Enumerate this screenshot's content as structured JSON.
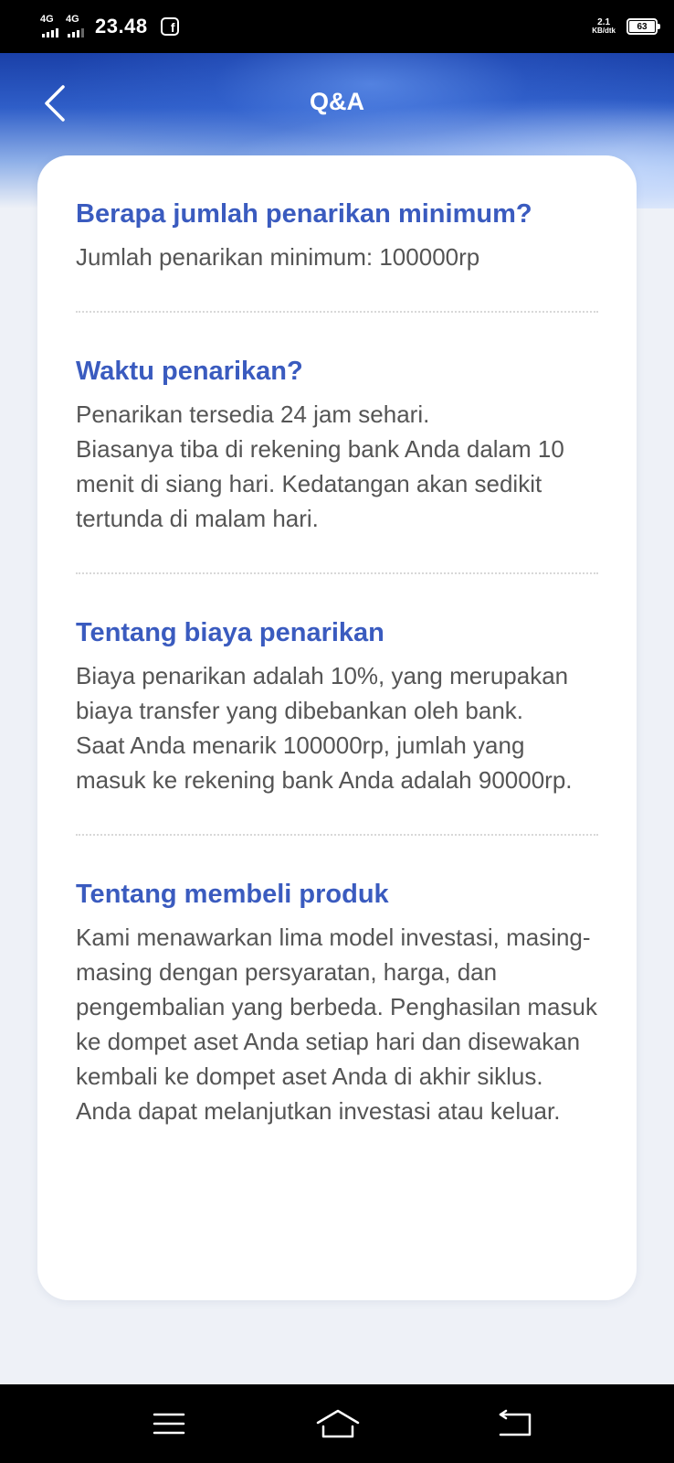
{
  "status_bar": {
    "sim1_label": "4G",
    "sim2_label": "4G",
    "time": "23.48",
    "notification_icon": "facebook-icon",
    "speed_value": "2.1",
    "speed_unit": "KB/dtk",
    "battery": "63"
  },
  "header": {
    "title": "Q&A",
    "back_icon": "chevron-left-icon"
  },
  "qa": [
    {
      "question": "Berapa jumlah penarikan minimum?",
      "answer": "Jumlah penarikan minimum: 100000rp"
    },
    {
      "question": "Waktu penarikan?",
      "answer": "Penarikan tersedia 24 jam sehari.\nBiasanya tiba di rekening bank Anda dalam 10 menit di siang hari. Kedatangan akan sedikit tertunda di malam hari."
    },
    {
      "question": "Tentang biaya penarikan",
      "answer": "Biaya penarikan adalah 10%, yang merupakan biaya transfer yang dibebankan oleh bank.\nSaat Anda menarik 100000rp, jumlah yang masuk ke rekening bank Anda adalah 90000rp."
    },
    {
      "question": "Tentang membeli produk",
      "answer": "Kami menawarkan lima model investasi, masing-masing dengan persyaratan, harga, dan pengembalian yang berbeda. Penghasilan masuk ke dompet aset Anda setiap hari dan disewakan kembali ke dompet aset Anda di akhir siklus. Anda dapat melanjutkan investasi atau keluar."
    }
  ],
  "nav_bar": {
    "menu_icon": "menu-icon",
    "home_icon": "home-icon",
    "back_icon": "back-icon"
  },
  "colors": {
    "question": "#3a5bbf",
    "answer": "#555555",
    "header_blue": "#1a40a8"
  }
}
